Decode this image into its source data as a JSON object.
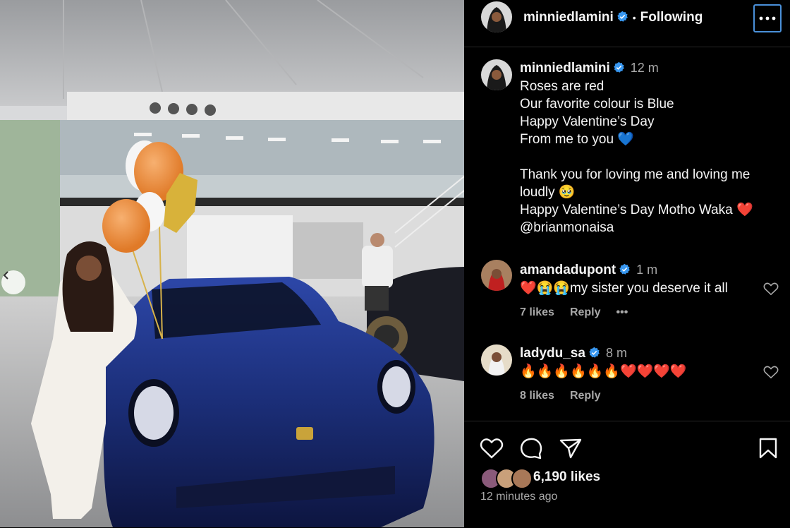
{
  "post": {
    "author": "minniedlamini",
    "follow_status": "Following",
    "caption_time": "12 m",
    "caption_lines": [
      "Roses are red",
      "Our favorite colour is Blue",
      "Happy Valentine’s Day",
      "From me to you 💙",
      "",
      "Thank you for loving me and loving me",
      "loudly 🥹",
      "Happy Valentine’s Day Motho Waka ❤️",
      "@brianmonaisa"
    ]
  },
  "comments": [
    {
      "user": "amandadupont",
      "time": "1 m",
      "text": "❤️😭😭my sister you deserve it all",
      "likes": "7 likes",
      "reply": "Reply",
      "more": "•••"
    },
    {
      "user": "ladydu_sa",
      "time": "8 m",
      "text": "🔥🔥🔥🔥🔥🔥❤️❤️❤️❤️",
      "likes": "8 likes",
      "reply": "Reply"
    }
  ],
  "engagement": {
    "likes": "6,190 likes",
    "posted": "12 minutes ago"
  },
  "icons": {
    "verified": "verified-badge-icon",
    "more": "more-options-icon",
    "like": "heart-icon",
    "comment": "comment-bubble-icon",
    "share": "send-icon",
    "save": "bookmark-icon",
    "prev": "chevron-left-icon"
  },
  "colors": {
    "verified_blue": "#3897f0",
    "background": "#000000",
    "secondary_text": "#a8a8a8",
    "car_blue": "#1b2e78",
    "balloon_orange": "#f08d3c",
    "focus_outline": "#4a90d9"
  }
}
